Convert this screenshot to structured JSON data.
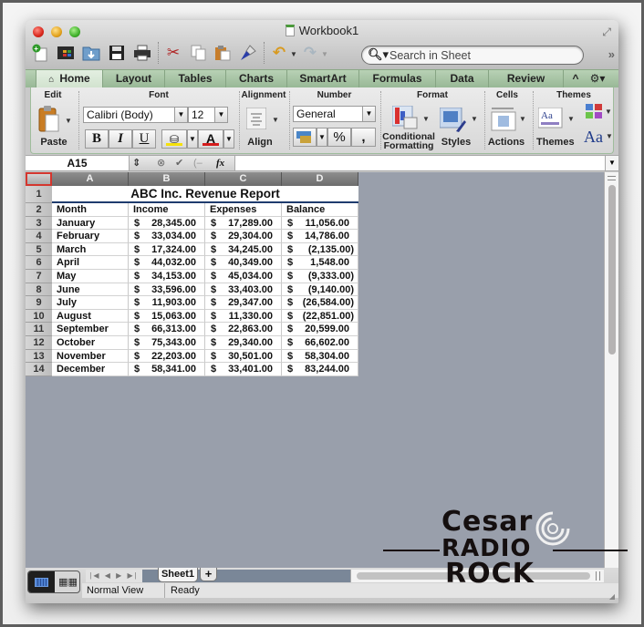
{
  "window": {
    "title": "Workbook1"
  },
  "toolbar": {
    "search_placeholder": "Search in Sheet",
    "buttons": [
      "new-workbook",
      "templates",
      "open",
      "save",
      "print",
      "cut",
      "copy",
      "paste",
      "format-painter",
      "undo",
      "redo"
    ]
  },
  "ribbon": {
    "tabs": [
      {
        "label": "Home",
        "active": true
      },
      {
        "label": "Layout",
        "active": false
      },
      {
        "label": "Tables",
        "active": false
      },
      {
        "label": "Charts",
        "active": false
      },
      {
        "label": "SmartArt",
        "active": false
      },
      {
        "label": "Formulas",
        "active": false
      },
      {
        "label": "Data",
        "active": false
      },
      {
        "label": "Review",
        "active": false
      }
    ],
    "groups": {
      "edit": {
        "title": "Edit",
        "paste_label": "Paste"
      },
      "font": {
        "title": "Font",
        "font_name": "Calibri (Body)",
        "font_size": "12",
        "bold": "B",
        "italic": "I",
        "underline": "U",
        "highlight_color": "#f5e10a",
        "font_color": "#d41c1c"
      },
      "alignment": {
        "title": "Alignment",
        "align_label": "Align"
      },
      "number": {
        "title": "Number",
        "format": "General",
        "percent": "%",
        "comma": ","
      },
      "format": {
        "title": "Format",
        "conditional_label_1": "Conditional",
        "conditional_label_2": "Formatting",
        "styles_label": "Styles"
      },
      "cells": {
        "title": "Cells",
        "actions_label": "Actions"
      },
      "themes": {
        "title": "Themes",
        "themes_label": "Themes",
        "fonts_glyph": "Aa"
      }
    }
  },
  "formula_bar": {
    "name_box": "A15",
    "fx": "fx",
    "formula": ""
  },
  "sheet": {
    "columns": [
      "A",
      "B",
      "C",
      "D"
    ],
    "title": "ABC Inc. Revenue Report",
    "headers": [
      "Month",
      "Income",
      "Expenses",
      "Balance"
    ],
    "currency_symbol": "$",
    "rows": [
      {
        "row": "3",
        "month": "January",
        "income": "28,345.00",
        "expenses": "17,289.00",
        "balance": "11,056.00",
        "negative": false
      },
      {
        "row": "4",
        "month": "February",
        "income": "33,034.00",
        "expenses": "29,304.00",
        "balance": "14,786.00",
        "negative": false
      },
      {
        "row": "5",
        "month": "March",
        "income": "17,324.00",
        "expenses": "34,245.00",
        "balance": "(2,135.00)",
        "negative": true
      },
      {
        "row": "6",
        "month": "April",
        "income": "44,032.00",
        "expenses": "40,349.00",
        "balance": "1,548.00",
        "negative": false
      },
      {
        "row": "7",
        "month": "May",
        "income": "34,153.00",
        "expenses": "45,034.00",
        "balance": "(9,333.00)",
        "negative": true
      },
      {
        "row": "8",
        "month": "June",
        "income": "33,596.00",
        "expenses": "33,403.00",
        "balance": "(9,140.00)",
        "negative": true
      },
      {
        "row": "9",
        "month": "July",
        "income": "11,903.00",
        "expenses": "29,347.00",
        "balance": "(26,584.00)",
        "negative": true
      },
      {
        "row": "10",
        "month": "August",
        "income": "15,063.00",
        "expenses": "11,330.00",
        "balance": "(22,851.00)",
        "negative": true
      },
      {
        "row": "11",
        "month": "September",
        "income": "66,313.00",
        "expenses": "22,863.00",
        "balance": "20,599.00",
        "negative": false
      },
      {
        "row": "12",
        "month": "October",
        "income": "75,343.00",
        "expenses": "29,340.00",
        "balance": "66,602.00",
        "negative": false
      },
      {
        "row": "13",
        "month": "November",
        "income": "22,203.00",
        "expenses": "30,501.00",
        "balance": "58,304.00",
        "negative": false
      },
      {
        "row": "14",
        "month": "December",
        "income": "58,341.00",
        "expenses": "33,401.00",
        "balance": "83,244.00",
        "negative": false
      }
    ]
  },
  "sheet_tabs": [
    {
      "label": "Sheet1",
      "active": true
    }
  ],
  "add_sheet_label": "+",
  "status_bar": {
    "view": "Normal View",
    "state": "Ready"
  },
  "watermark": {
    "line1": "Cesar",
    "line2": "RADIO",
    "line3": "ROCK"
  }
}
